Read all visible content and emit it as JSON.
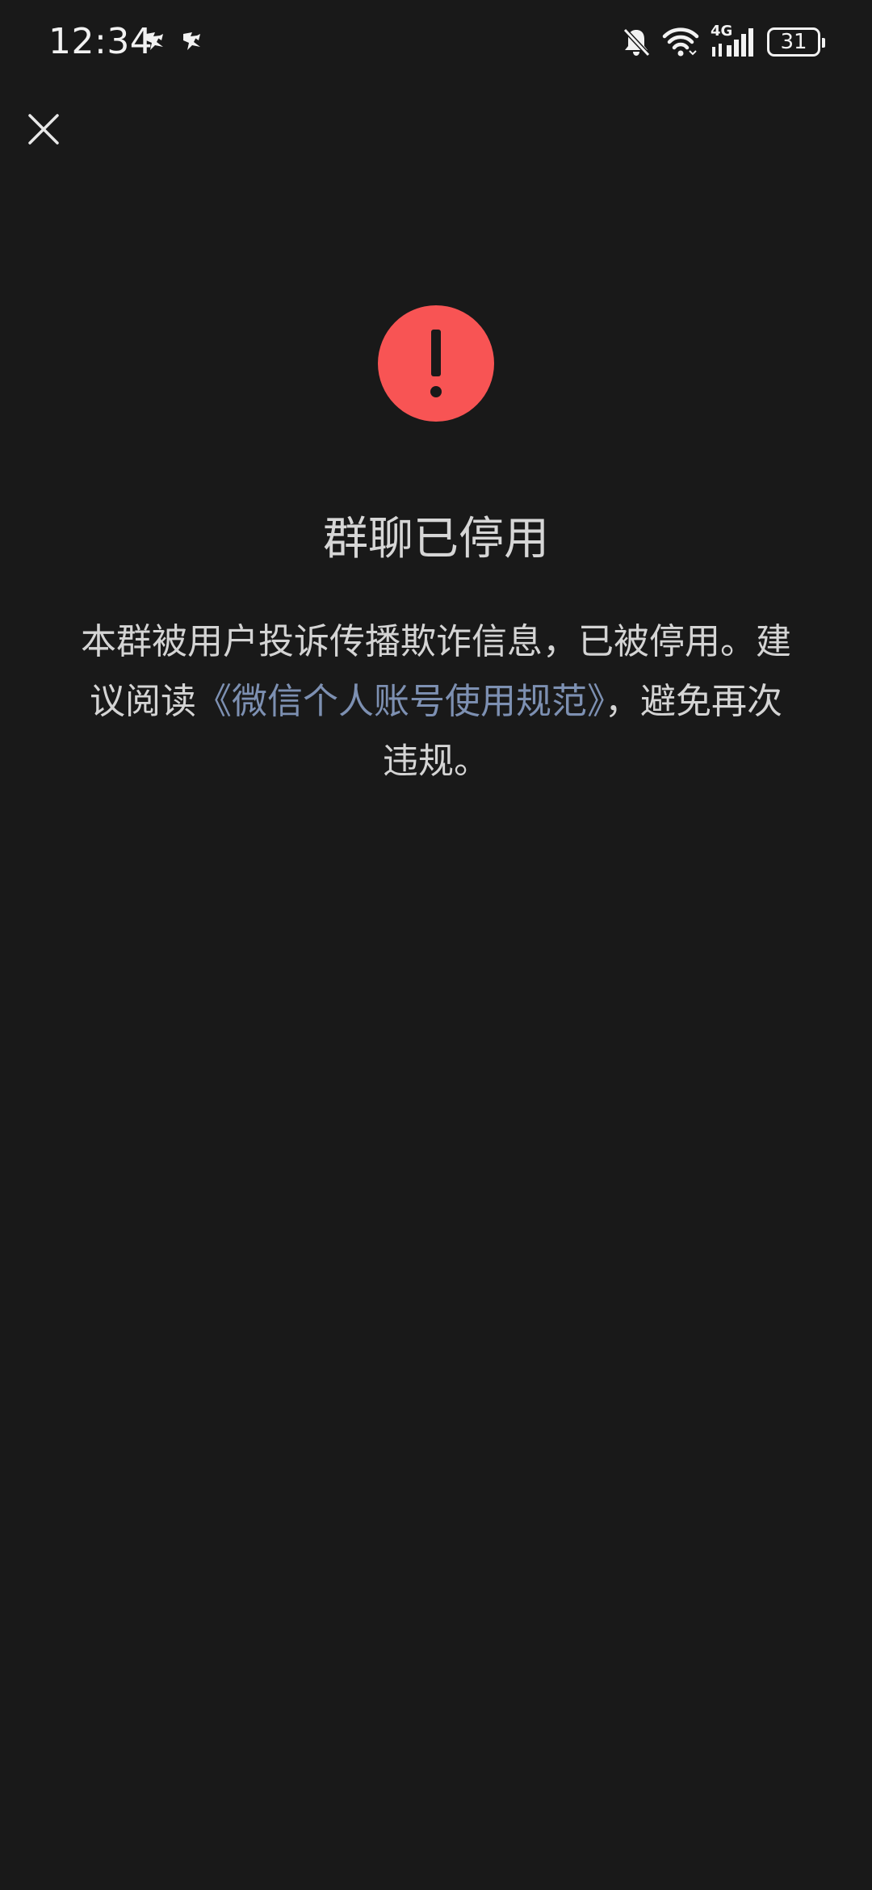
{
  "status_bar": {
    "time": "12:34",
    "battery": "31",
    "network": "4G",
    "icons": [
      "notification-app-icon",
      "notification-app-icon",
      "bell-muted-icon",
      "wifi-icon",
      "cellular-signal-icon",
      "battery-icon"
    ]
  },
  "colors": {
    "background": "#191919",
    "alert": "#f85454",
    "link": "#7d90b2",
    "text": "#d6d6d6"
  },
  "header": {
    "close_icon": "close-icon"
  },
  "main": {
    "alert_icon": "exclamation-circle-icon",
    "title": "群聊已停用",
    "description_part1": "本群被用户投诉传播欺诈信息，已被停用。建议阅读",
    "link_text": "《微信个人账号使用规范》",
    "description_part2": "，避免再次违规。"
  }
}
